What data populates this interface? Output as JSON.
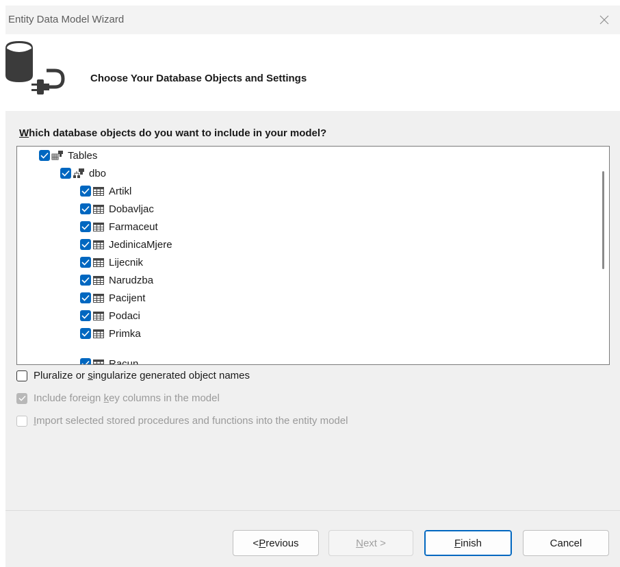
{
  "window": {
    "title": "Entity Data Model Wizard"
  },
  "header": {
    "title": "Choose Your Database Objects and Settings",
    "icon": "database-connection-icon"
  },
  "question": {
    "accel": "W",
    "rest": "hich database objects do you want to include in your model?"
  },
  "tree": {
    "root": {
      "label": "Tables",
      "checked": true,
      "icon": "tables-icon"
    },
    "schema": {
      "label": "dbo",
      "checked": true,
      "icon": "schema-icon"
    },
    "tables": [
      {
        "label": "Artikl",
        "checked": true
      },
      {
        "label": "Dobavljac",
        "checked": true
      },
      {
        "label": "Farmaceut",
        "checked": true
      },
      {
        "label": "JedinicaMjere",
        "checked": true
      },
      {
        "label": "Lijecnik",
        "checked": true
      },
      {
        "label": "Narudzba",
        "checked": true
      },
      {
        "label": "Pacijent",
        "checked": true
      },
      {
        "label": "Podaci",
        "checked": true
      },
      {
        "label": "Primka",
        "checked": true
      },
      {
        "label": "Racun",
        "checked": true
      }
    ]
  },
  "options": {
    "pluralize": {
      "before": "Pluralize or ",
      "accel": "s",
      "after": "ingularize generated object names",
      "checked": false,
      "enabled": true
    },
    "foreign_keys": {
      "before": "Include foreign ",
      "accel": "k",
      "after": "ey columns in the model",
      "checked": true,
      "enabled": false
    },
    "import_procs": {
      "before": "",
      "accel": "I",
      "after": "mport selected stored procedures and functions into the entity model",
      "checked": false,
      "enabled": false
    }
  },
  "buttons": {
    "previous": {
      "before": "< ",
      "accel": "P",
      "after": "revious",
      "enabled": true
    },
    "next": {
      "before": "",
      "accel": "N",
      "after": "ext >",
      "enabled": false
    },
    "finish": {
      "before": "",
      "accel": "F",
      "after": "inish",
      "enabled": true
    },
    "cancel": {
      "label": "Cancel",
      "enabled": true
    }
  },
  "colors": {
    "checkbox_accent": "#0067c0",
    "window_bg": "#f0f0f0",
    "disabled_text": "#9a9a9a"
  }
}
